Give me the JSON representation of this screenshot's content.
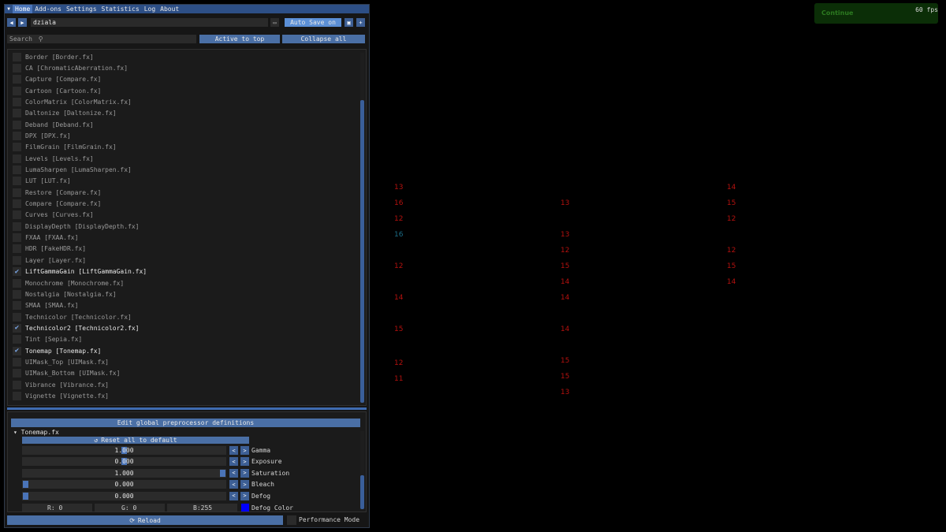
{
  "menu": {
    "tabs": [
      "Home",
      "Add-ons",
      "Settings",
      "Statistics",
      "Log",
      "About"
    ]
  },
  "preset": {
    "name": "dziala",
    "autosave_label": "Auto Save on"
  },
  "search": {
    "placeholder": "Search",
    "active_top_label": "Active to top",
    "collapse_label": "Collapse all"
  },
  "effects": [
    {
      "label": "Border [Border.fx]",
      "checked": false
    },
    {
      "label": "CA [ChromaticAberration.fx]",
      "checked": false
    },
    {
      "label": "Capture [Compare.fx]",
      "checked": false
    },
    {
      "label": "Cartoon [Cartoon.fx]",
      "checked": false
    },
    {
      "label": "ColorMatrix [ColorMatrix.fx]",
      "checked": false
    },
    {
      "label": "Daltonize [Daltonize.fx]",
      "checked": false
    },
    {
      "label": "Deband [Deband.fx]",
      "checked": false
    },
    {
      "label": "DPX [DPX.fx]",
      "checked": false
    },
    {
      "label": "FilmGrain [FilmGrain.fx]",
      "checked": false
    },
    {
      "label": "Levels [Levels.fx]",
      "checked": false
    },
    {
      "label": "LumaSharpen [LumaSharpen.fx]",
      "checked": false
    },
    {
      "label": "LUT [LUT.fx]",
      "checked": false
    },
    {
      "label": "Restore [Compare.fx]",
      "checked": false
    },
    {
      "label": "Compare [Compare.fx]",
      "checked": false
    },
    {
      "label": "Curves [Curves.fx]",
      "checked": false
    },
    {
      "label": "DisplayDepth [DisplayDepth.fx]",
      "checked": false
    },
    {
      "label": "FXAA [FXAA.fx]",
      "checked": false
    },
    {
      "label": "HDR [FakeHDR.fx]",
      "checked": false
    },
    {
      "label": "Layer [Layer.fx]",
      "checked": false
    },
    {
      "label": "LiftGammaGain [LiftGammaGain.fx]",
      "checked": true
    },
    {
      "label": "Monochrome [Monochrome.fx]",
      "checked": false
    },
    {
      "label": "Nostalgia [Nostalgia.fx]",
      "checked": false
    },
    {
      "label": "SMAA [SMAA.fx]",
      "checked": false
    },
    {
      "label": "Technicolor [Technicolor.fx]",
      "checked": false
    },
    {
      "label": "Technicolor2 [Technicolor2.fx]",
      "checked": true
    },
    {
      "label": "Tint [Sepia.fx]",
      "checked": false
    },
    {
      "label": "Tonemap [Tonemap.fx]",
      "checked": true
    },
    {
      "label": "UIMask_Top [UIMask.fx]",
      "checked": false
    },
    {
      "label": "UIMask_Bottom [UIMask.fx]",
      "checked": false
    },
    {
      "label": "Vibrance [Vibrance.fx]",
      "checked": false
    },
    {
      "label": "Vignette [Vignette.fx]",
      "checked": false
    }
  ],
  "params": {
    "preprocessor_label": "Edit global preprocessor definitions",
    "section_title": "Tonemap.fx",
    "reset_label": "Reset all to default",
    "sliders": [
      {
        "label": "Gamma",
        "value": "1.000",
        "fraction": 0.5
      },
      {
        "label": "Exposure",
        "value": "0.000",
        "fraction": 0.5
      },
      {
        "label": "Saturation",
        "value": "1.000",
        "fraction": 1.0
      },
      {
        "label": "Bleach",
        "value": "0.000",
        "fraction": 0.0
      },
      {
        "label": "Defog",
        "value": "0.000",
        "fraction": 0.0
      }
    ],
    "color": {
      "r": "R:  0",
      "g": "G:  0",
      "b": "B:255",
      "swatch": "#0000ff",
      "label": "Defog Color"
    }
  },
  "footer": {
    "reload_label": "Reload",
    "perf_label": "Performance Mode"
  },
  "overlay": {
    "fps": "60 fps",
    "continue_label": "Continue"
  },
  "background_numbers": {
    "col1": [
      "13",
      "16",
      "12",
      "16",
      "12",
      "14",
      "15",
      "12",
      "11"
    ],
    "col2": [
      "13",
      "13",
      "12",
      "15",
      "14",
      "14",
      "14",
      "15",
      "15",
      "13"
    ],
    "col3": [
      "14",
      "15",
      "12",
      "12",
      "15",
      "14"
    ]
  }
}
